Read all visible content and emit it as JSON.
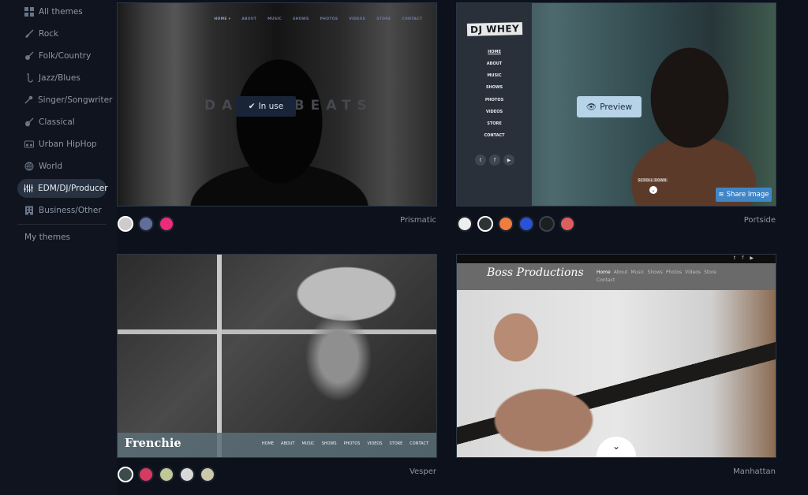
{
  "sidebar": {
    "items": [
      {
        "label": "All themes",
        "icon": "grid-icon"
      },
      {
        "label": "Rock",
        "icon": "electric-guitar-icon"
      },
      {
        "label": "Folk/Country",
        "icon": "banjo-icon"
      },
      {
        "label": "Jazz/Blues",
        "icon": "saxophone-icon"
      },
      {
        "label": "Singer/Songwriter",
        "icon": "microphone-icon"
      },
      {
        "label": "Classical",
        "icon": "violin-icon"
      },
      {
        "label": "Urban HipHop",
        "icon": "boombox-icon"
      },
      {
        "label": "World",
        "icon": "globe-icon"
      },
      {
        "label": "EDM/DJ/Producer",
        "icon": "mixer-sliders-icon",
        "active": true
      },
      {
        "label": "Business/Other",
        "icon": "building-icon"
      }
    ],
    "my_themes": "My themes"
  },
  "themes": [
    {
      "name": "Prismatic",
      "badge": "In use",
      "preview": {
        "site_title": "DAVID BEATS",
        "nav": [
          "HOME ▾",
          "ABOUT",
          "MUSIC",
          "SHOWS",
          "PHOTOS",
          "VIDEOS",
          "STORE",
          "CONTACT"
        ]
      },
      "swatches": [
        "#cccccc",
        "#5f6f9a",
        "#ee2a7b"
      ],
      "selected_swatch": 0
    },
    {
      "name": "Portside",
      "preview_button": "Preview",
      "share_button": "Share Image",
      "preview": {
        "site_title": "DJ WHEY",
        "nav": [
          "HOME",
          "ABOUT",
          "MUSIC",
          "SHOWS",
          "PHOTOS",
          "VIDEOS",
          "STORE",
          "CONTACT"
        ],
        "scroll_label": "SCROLL DOWN"
      },
      "swatches": [
        "#eeeeee",
        "#2d3436",
        "#ef7d3e",
        "#2952d6",
        "#1d1f1f",
        "#dd5e5e"
      ],
      "selected_swatch": 1
    },
    {
      "name": "Vesper",
      "preview": {
        "site_title": "Frenchie",
        "nav": [
          "HOME",
          "ABOUT",
          "MUSIC",
          "SHOWS",
          "PHOTOS",
          "VIDEOS",
          "STORE",
          "CONTACT"
        ]
      },
      "swatches": [
        "#3d4b4b",
        "#d63a63",
        "#bfc896",
        "#d9d9d9",
        "#cdc8aa"
      ],
      "selected_swatch": 0
    },
    {
      "name": "Manhattan",
      "preview": {
        "site_title": "Boss Productions",
        "nav": [
          "Home",
          "About",
          "Music",
          "Shows",
          "Photos",
          "Videos",
          "Store",
          "Contact"
        ]
      },
      "swatches": [],
      "selected_swatch": null
    }
  ]
}
